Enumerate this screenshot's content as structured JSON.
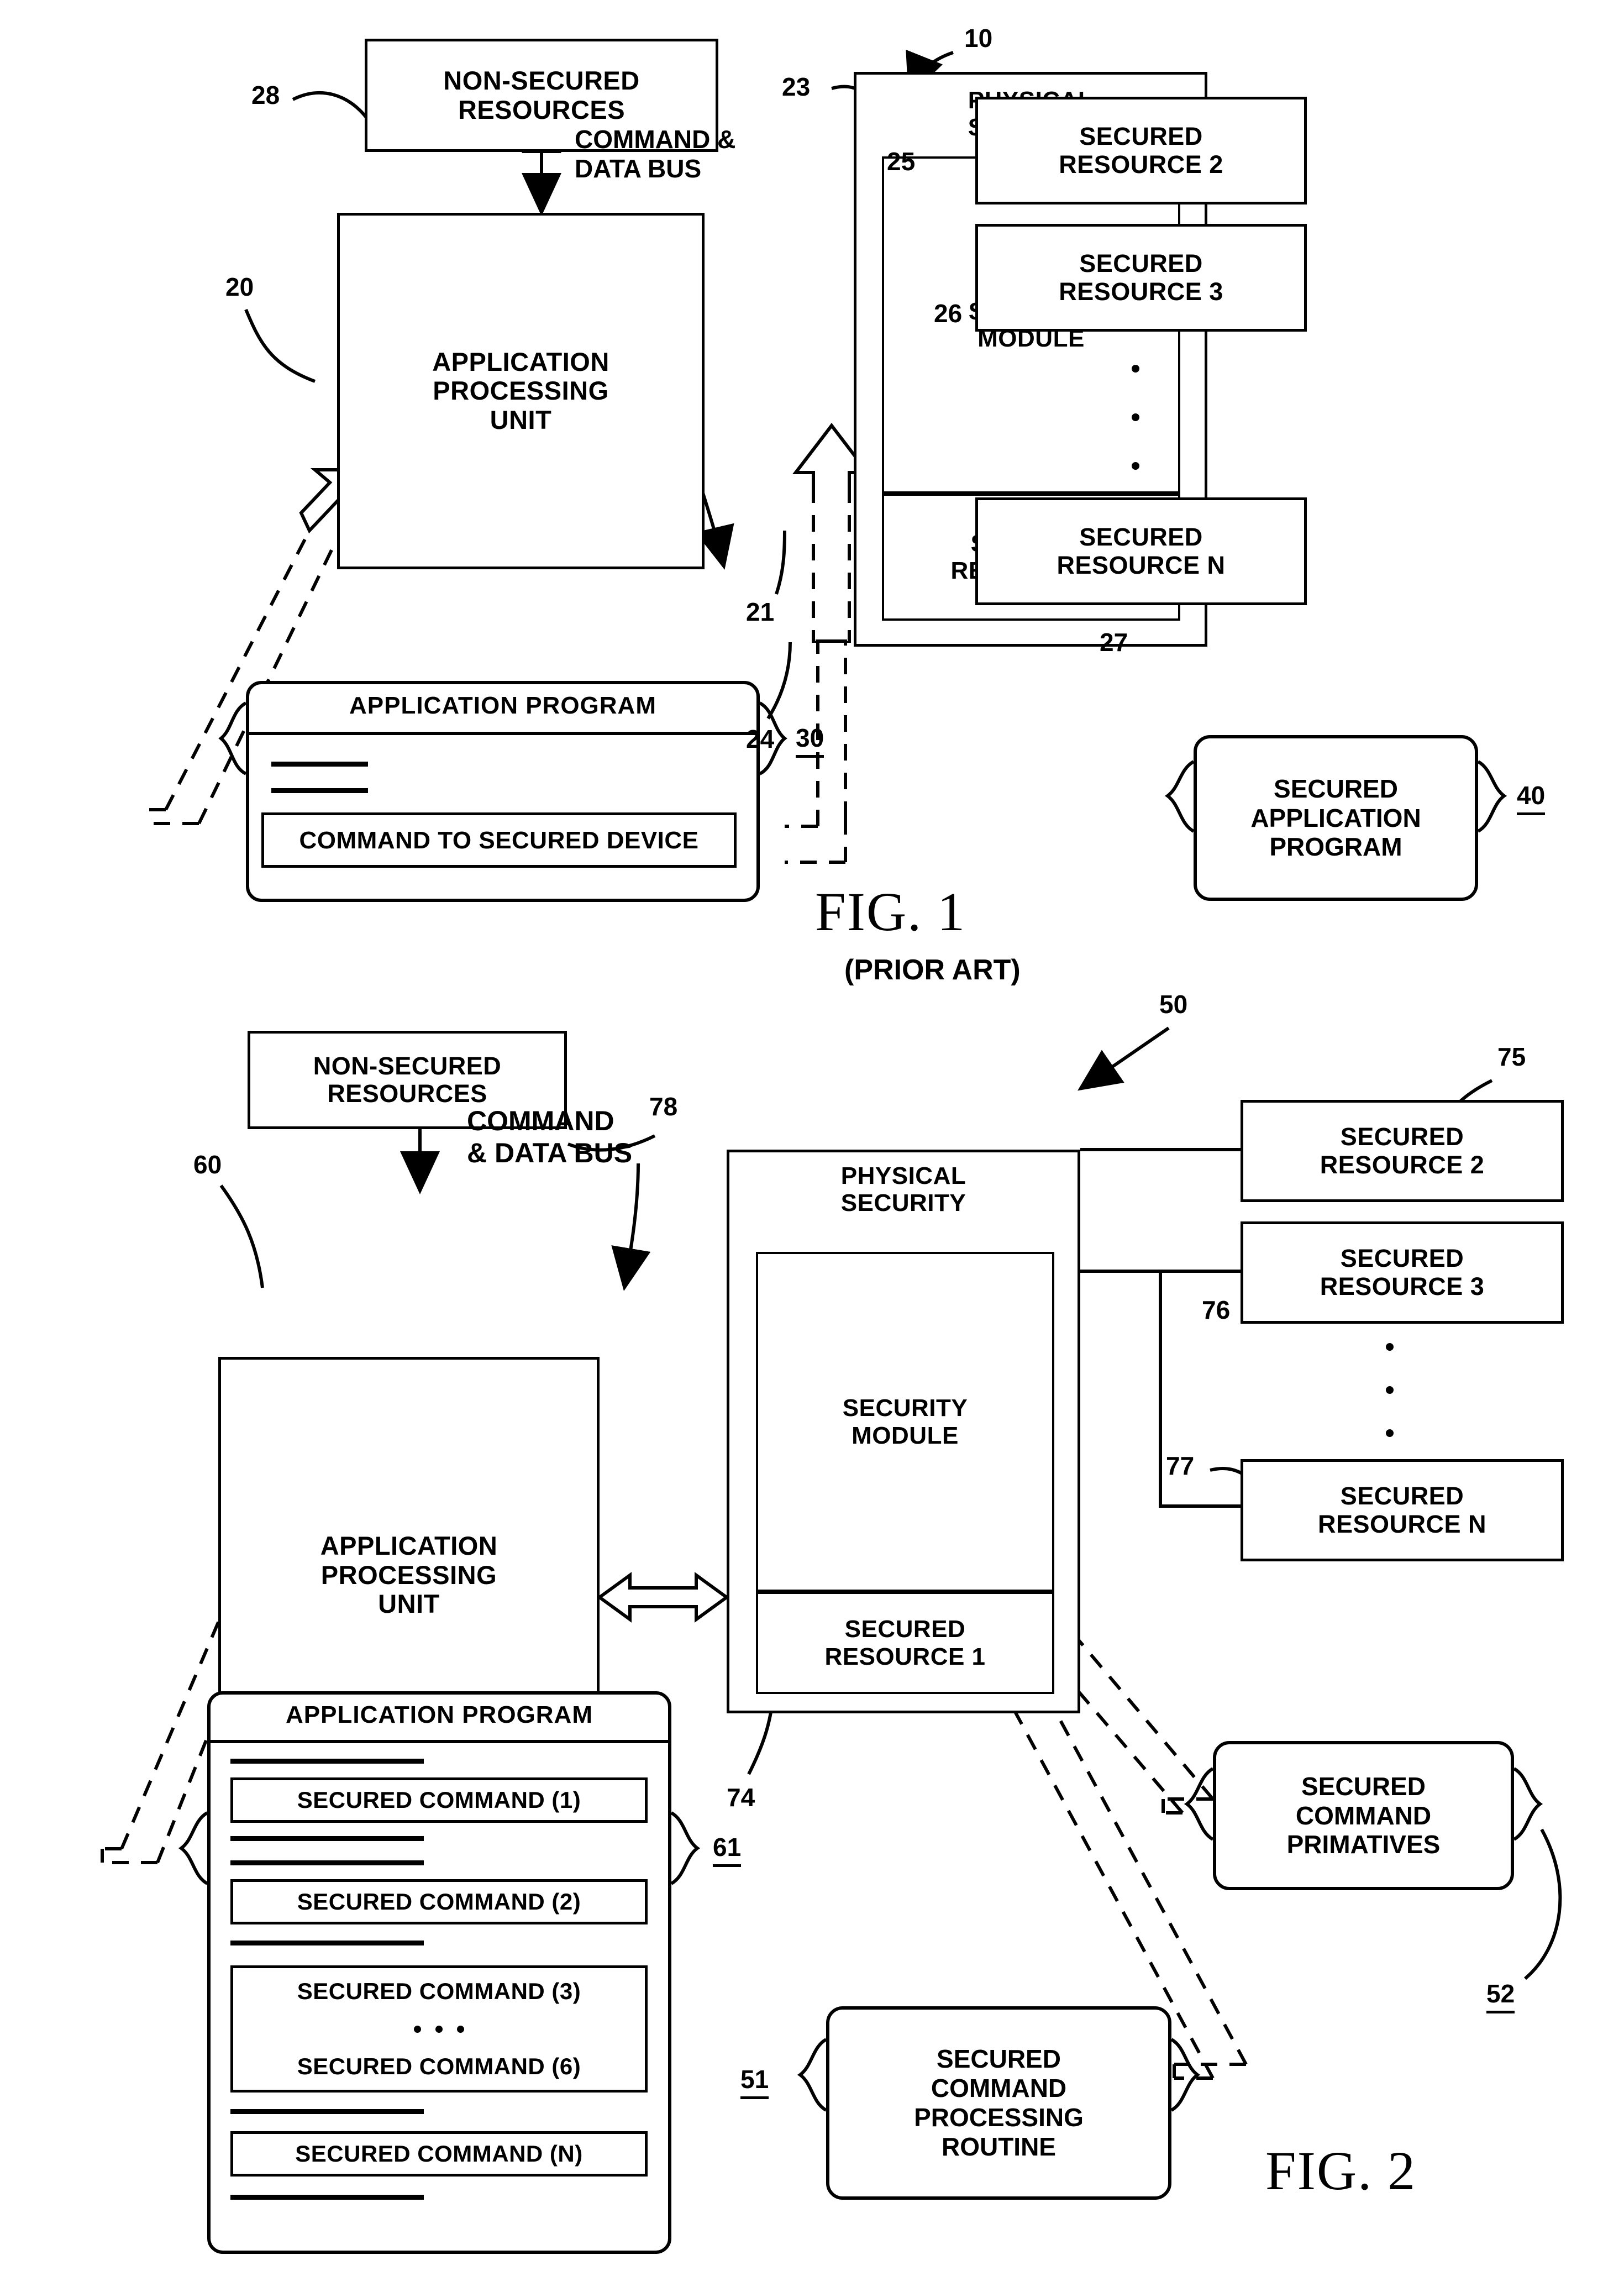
{
  "document": {
    "type": "patent-drawing-sheet",
    "figures": [
      {
        "id": "fig1",
        "caption": "FIG.  1",
        "subcaption": "(PRIOR ART)",
        "blocks": {
          "non_secured_resources": "NON-SECURED\nRESOURCES",
          "application_processing_unit": "APPLICATION\nPROCESSING\nUNIT",
          "physical_security": "PHYSICAL\nSECURITY",
          "security_module": "SECURITY\nMODULE",
          "secured_resource_1": "SECURED\nRESOURCE 1",
          "secured_resource_2": "SECURED\nRESOURCE 2",
          "secured_resource_3": "SECURED\nRESOURCE 3",
          "secured_resource_n": "SECURED\nRESOURCE N",
          "secured_application_program": "SECURED\nAPPLICATION\nPROGRAM",
          "application_program_title": "APPLICATION PROGRAM",
          "command_to_secured_device": "COMMAND TO SECURED DEVICE"
        },
        "bus_label": "COMMAND &\nDATA BUS",
        "reference_numerals": {
          "system": "10",
          "apu": "20",
          "bus": "21",
          "physical_security": "23",
          "secured_resource_1": "24",
          "secured_resource_2": "25",
          "secured_resource_3": "26",
          "secured_resource_n": "27",
          "non_secured_resources": "28",
          "application_program": "30",
          "secured_application_program": "40"
        }
      },
      {
        "id": "fig2",
        "caption": "FIG.  2",
        "blocks": {
          "non_secured_resources": "NON-SECURED\nRESOURCES",
          "application_processing_unit": "APPLICATION\nPROCESSING\nUNIT",
          "physical_security": "PHYSICAL\nSECURITY",
          "security_module": "SECURITY\nMODULE",
          "secured_resource_1": "SECURED\nRESOURCE 1",
          "secured_resource_2": "SECURED\nRESOURCE 2",
          "secured_resource_3": "SECURED\nRESOURCE 3",
          "secured_resource_n": "SECURED\nRESOURCE N",
          "secured_command_primitives": "SECURED\nCOMMAND\nPRIMATIVES",
          "secured_command_processing_routine": "SECURED\nCOMMAND\nPROCESSING\nROUTINE",
          "application_program_title": "APPLICATION PROGRAM"
        },
        "bus_label": "COMMAND\n& DATA BUS",
        "secured_commands": [
          "SECURED  COMMAND (1)",
          "SECURED  COMMAND (2)",
          "SECURED  COMMAND (3)",
          "SECURED  COMMAND (6)",
          "SECURED  COMMAND (N)"
        ],
        "reference_numerals": {
          "system": "50",
          "secured_command_processing_routine": "51",
          "secured_command_primitives": "52",
          "apu": "60",
          "application_program": "61",
          "secured_resource_1": "74",
          "secured_resource_2": "75",
          "secured_resource_3": "76",
          "secured_resource_n": "77",
          "non_secured_resources": "78"
        }
      }
    ],
    "colors": {
      "ink": "#000000",
      "paper": "#ffffff"
    }
  }
}
